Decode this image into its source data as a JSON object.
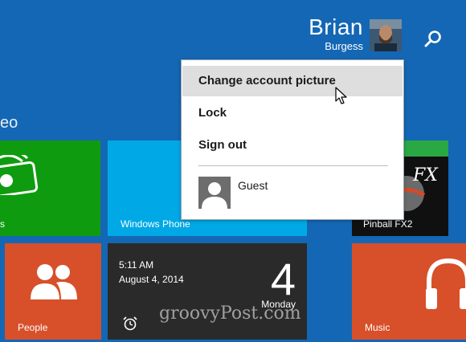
{
  "user": {
    "first_name": "Brian",
    "last_name": "Burgess"
  },
  "section": {
    "title_fragment": "eo"
  },
  "menu": {
    "items": [
      {
        "label": "Change account picture"
      },
      {
        "label": "Lock"
      },
      {
        "label": "Sign out"
      }
    ],
    "other_account": {
      "name": "Guest"
    }
  },
  "tiles": {
    "xbox": {
      "label_fragment": "s",
      "color": "#0f9b0f"
    },
    "windows_phone": {
      "label": "Windows Phone",
      "color": "#00a9e6"
    },
    "pinball": {
      "label": "Pinball FX2",
      "color": "#101010"
    },
    "people": {
      "label": "People",
      "color": "#d7502a"
    },
    "clock": {
      "time": "5:11 AM",
      "date": "August 4, 2014",
      "day_number": "4",
      "day_name": "Monday",
      "color": "#2a2a2a"
    },
    "music": {
      "label": "Music",
      "color": "#d7502a"
    }
  },
  "watermark": "groovyPost.com",
  "colors": {
    "background": "#1467b4",
    "menu_hover": "#dedede"
  }
}
